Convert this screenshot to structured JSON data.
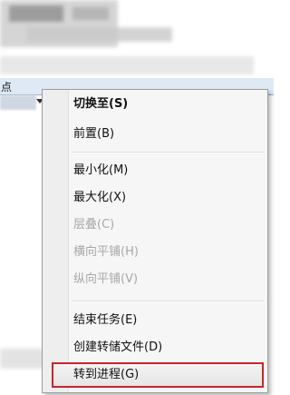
{
  "header": {
    "column_label": "点"
  },
  "menu": {
    "items": [
      {
        "label": "切换至(S)"
      },
      {
        "label": "前置(B)"
      },
      {
        "label": "最小化(M)"
      },
      {
        "label": "最大化(X)"
      },
      {
        "label": "层叠(C)"
      },
      {
        "label": "横向平铺(H)"
      },
      {
        "label": "纵向平铺(V)"
      },
      {
        "label": "结束任务(E)"
      },
      {
        "label": "创建转储文件(D)"
      },
      {
        "label": "转到进程(G)"
      }
    ]
  },
  "colors": {
    "highlight_border": "#c5262b",
    "disabled_text": "#a8a8a8"
  }
}
